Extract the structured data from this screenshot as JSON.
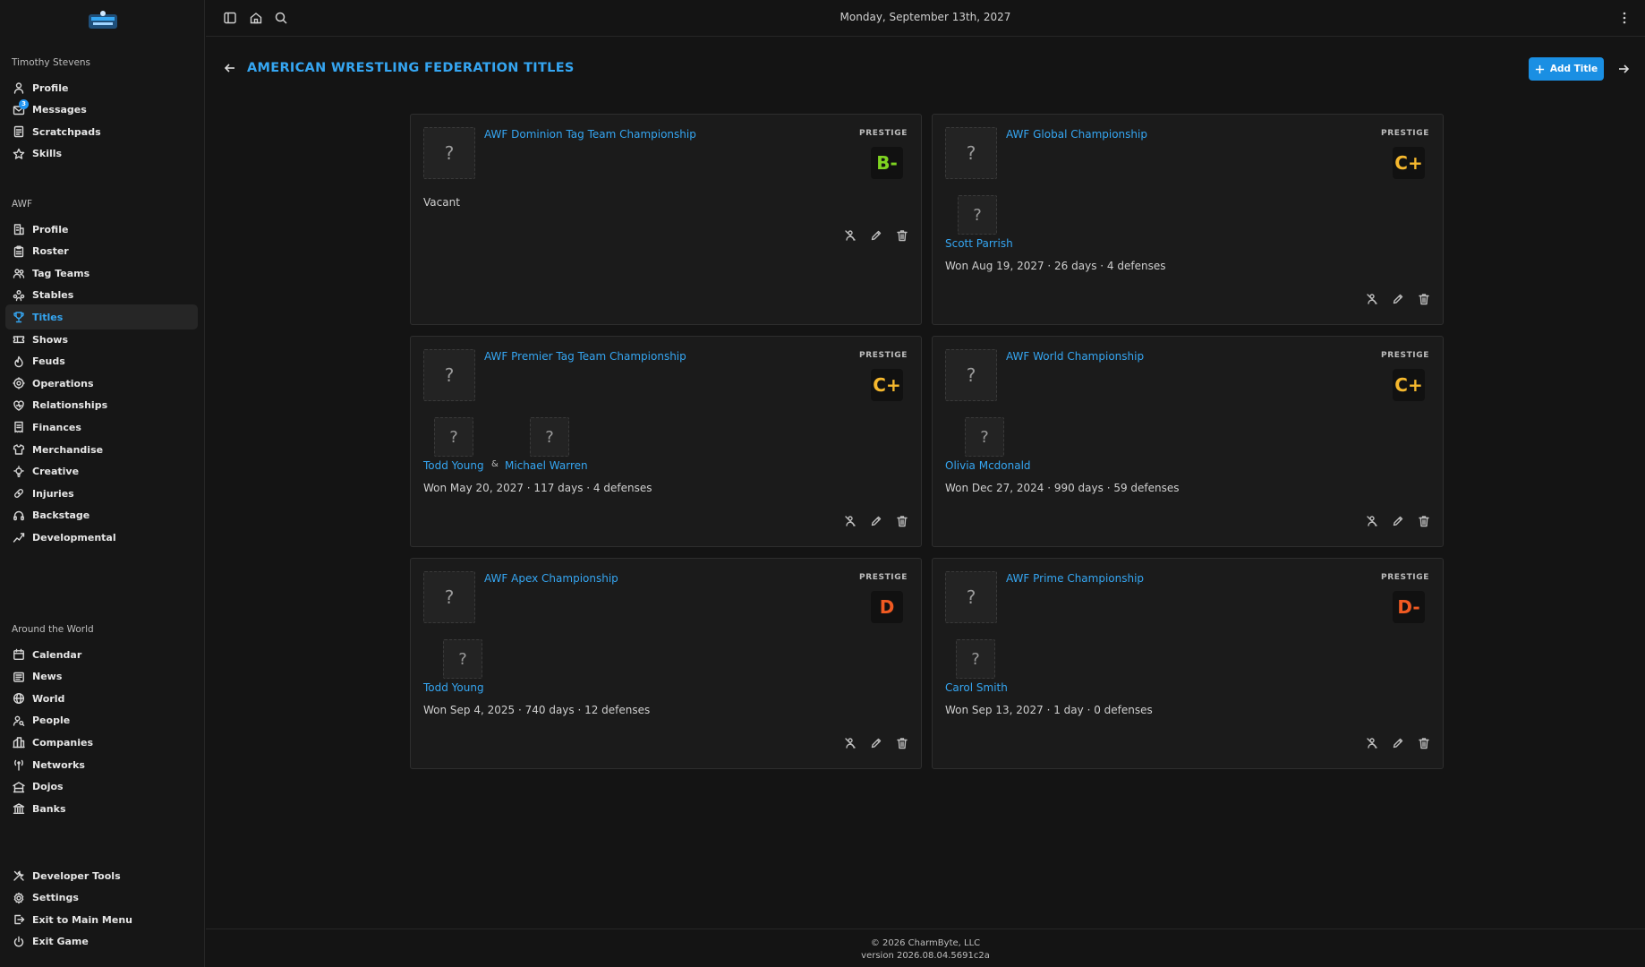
{
  "sidebar": {
    "user_name": "Timothy Stevens",
    "user_items": [
      {
        "label": "Profile",
        "icon": "user-icon"
      },
      {
        "label": "Messages",
        "icon": "mail-icon",
        "badge": "3"
      },
      {
        "label": "Scratchpads",
        "icon": "notepad-icon"
      },
      {
        "label": "Skills",
        "icon": "star-icon"
      }
    ],
    "company_section": "AWF",
    "company_items": [
      {
        "label": "Profile",
        "icon": "building-icon"
      },
      {
        "label": "Roster",
        "icon": "clipboard-icon"
      },
      {
        "label": "Tag Teams",
        "icon": "users-icon"
      },
      {
        "label": "Stables",
        "icon": "group-icon"
      },
      {
        "label": "Titles",
        "icon": "trophy-icon",
        "active": true
      },
      {
        "label": "Shows",
        "icon": "ticket-icon"
      },
      {
        "label": "Feuds",
        "icon": "flame-icon"
      },
      {
        "label": "Operations",
        "icon": "cog-icon"
      },
      {
        "label": "Relationships",
        "icon": "heart-icon"
      },
      {
        "label": "Finances",
        "icon": "receipt-icon"
      },
      {
        "label": "Merchandise",
        "icon": "shirt-icon"
      },
      {
        "label": "Creative",
        "icon": "bulb-icon"
      },
      {
        "label": "Injuries",
        "icon": "bandage-icon"
      },
      {
        "label": "Backstage",
        "icon": "headset-icon"
      },
      {
        "label": "Developmental",
        "icon": "trend-icon"
      }
    ],
    "world_section": "Around the World",
    "world_items": [
      {
        "label": "Calendar",
        "icon": "calendar-icon"
      },
      {
        "label": "News",
        "icon": "newspaper-icon"
      },
      {
        "label": "World",
        "icon": "globe-icon"
      },
      {
        "label": "People",
        "icon": "person-search-icon"
      },
      {
        "label": "Companies",
        "icon": "company-icon"
      },
      {
        "label": "Networks",
        "icon": "antenna-icon"
      },
      {
        "label": "Dojos",
        "icon": "dojo-icon"
      },
      {
        "label": "Banks",
        "icon": "bank-icon"
      }
    ],
    "bottom_items": [
      {
        "label": "Developer Tools",
        "icon": "tools-icon"
      },
      {
        "label": "Settings",
        "icon": "settings-icon"
      },
      {
        "label": "Exit to Main Menu",
        "icon": "exit-icon"
      },
      {
        "label": "Exit Game",
        "icon": "power-icon"
      }
    ]
  },
  "topbar": {
    "date": "Monday, September 13th, 2027"
  },
  "header": {
    "title": "AMERICAN WRESTLING FEDERATION TITLES",
    "add_label": "Add Title"
  },
  "colors": {
    "accent": "#35a6f2",
    "grade_b": "#7ed321",
    "grade_c": "#f5b82e",
    "grade_d": "#f05a22"
  },
  "prestige_label": "PRESTIGE",
  "titles": [
    {
      "name": "AWF Dominion Tag Team Championship",
      "grade": "B-",
      "grade_color": "#7ed321",
      "vacant_text": "Vacant",
      "champions": [],
      "reign": ""
    },
    {
      "name": "AWF Global Championship",
      "grade": "C+",
      "grade_color": "#f5b82e",
      "vacant_text": "",
      "champions": [
        "Scott Parrish"
      ],
      "reign": "Won Aug 19, 2027 · 26 days · 4 defenses"
    },
    {
      "name": "AWF Premier Tag Team Championship",
      "grade": "C+",
      "grade_color": "#f5b82e",
      "vacant_text": "",
      "champions": [
        "Todd Young",
        "Michael Warren"
      ],
      "separator": "&",
      "reign": "Won May 20, 2027 · 117 days · 4 defenses"
    },
    {
      "name": "AWF World Championship",
      "grade": "C+",
      "grade_color": "#f5b82e",
      "vacant_text": "",
      "champions": [
        "Olivia Mcdonald"
      ],
      "reign": "Won Dec 27, 2024 · 990 days · 59 defenses"
    },
    {
      "name": "AWF Apex Championship",
      "grade": "D",
      "grade_color": "#f05a22",
      "vacant_text": "",
      "champions": [
        "Todd Young"
      ],
      "reign": "Won Sep 4, 2025 · 740 days · 12 defenses"
    },
    {
      "name": "AWF Prime Championship",
      "grade": "D-",
      "grade_color": "#f05a22",
      "vacant_text": "",
      "champions": [
        "Carol Smith"
      ],
      "reign": "Won Sep 13, 2027 · 1 day · 0 defenses"
    }
  ],
  "placeholder_glyph": "?",
  "footer": {
    "copyright": "© 2026 CharmByte, LLC",
    "version": "version 2026.08.04.5691c2a"
  }
}
